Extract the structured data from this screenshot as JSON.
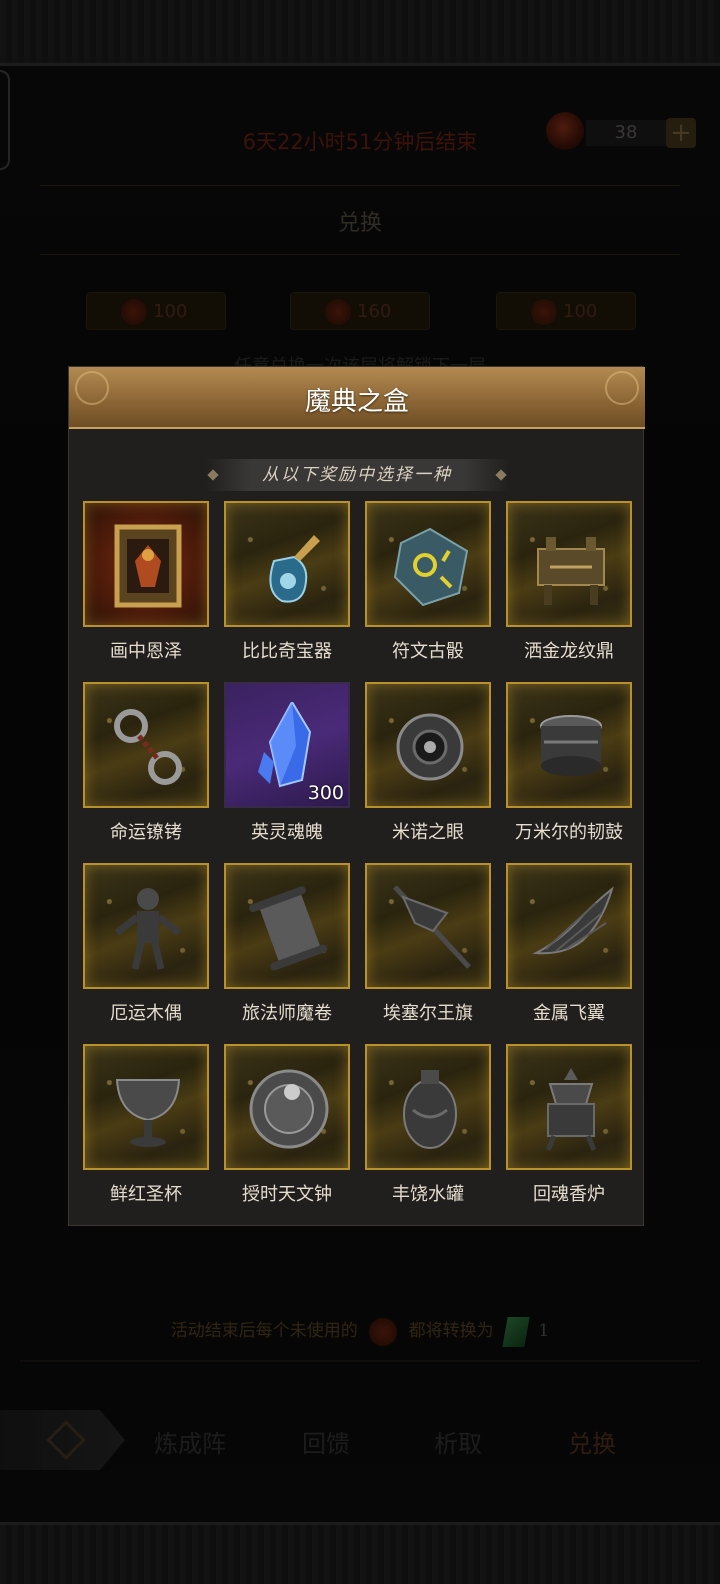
{
  "background": {
    "countdown": "6天22小时51分钟后结束",
    "currency_count": "38",
    "plus_label": "+",
    "section_title": "兑换",
    "prices": [
      "100",
      "160",
      "100"
    ],
    "dimmed_text": "任意兑换一次该层将解锁下一层",
    "bottom_note_prefix": "活动结束后每个未使用的",
    "bottom_note_suffix": "都将转换为",
    "bottom_note_count": "1",
    "nav": {
      "tabs": [
        "炼成阵",
        "回馈",
        "析取",
        "兑换"
      ],
      "active": "兑换"
    }
  },
  "modal": {
    "title": "魔典之盒",
    "subtitle": "从以下奖励中选择一种",
    "items": [
      {
        "label": "画中恩泽",
        "icon": "framed-portrait-icon",
        "style": "red"
      },
      {
        "label": "比比奇宝器",
        "icon": "glowing-flask-icon",
        "style": "gold"
      },
      {
        "label": "符文古骰",
        "icon": "rune-dice-icon",
        "style": "gold"
      },
      {
        "label": "洒金龙纹鼎",
        "icon": "bronze-cauldron-icon",
        "style": "gold"
      },
      {
        "label": "命运镣铐",
        "icon": "spiked-shackles-icon",
        "style": "gold"
      },
      {
        "label": "英灵魂魄",
        "icon": "blue-crystal-icon",
        "style": "purple",
        "qty": "300"
      },
      {
        "label": "米诺之眼",
        "icon": "eye-orb-icon",
        "style": "gold"
      },
      {
        "label": "万米尔的韧鼓",
        "icon": "drum-icon",
        "style": "gold"
      },
      {
        "label": "厄运木偶",
        "icon": "puppet-icon",
        "style": "gold"
      },
      {
        "label": "旅法师魔卷",
        "icon": "scroll-icon",
        "style": "gold"
      },
      {
        "label": "埃塞尔王旗",
        "icon": "banner-icon",
        "style": "gold"
      },
      {
        "label": "金属飞翼",
        "icon": "metal-wing-icon",
        "style": "gold"
      },
      {
        "label": "鲜红圣杯",
        "icon": "chalice-icon",
        "style": "gold"
      },
      {
        "label": "授时天文钟",
        "icon": "astronomical-clock-icon",
        "style": "gold"
      },
      {
        "label": "丰饶水罐",
        "icon": "water-jar-icon",
        "style": "gold"
      },
      {
        "label": "回魂香炉",
        "icon": "incense-burner-icon",
        "style": "gold"
      }
    ]
  },
  "colors": {
    "gold_border": "#b8902c",
    "modal_header": "#8a6434",
    "countdown_red": "#5c1c12"
  }
}
